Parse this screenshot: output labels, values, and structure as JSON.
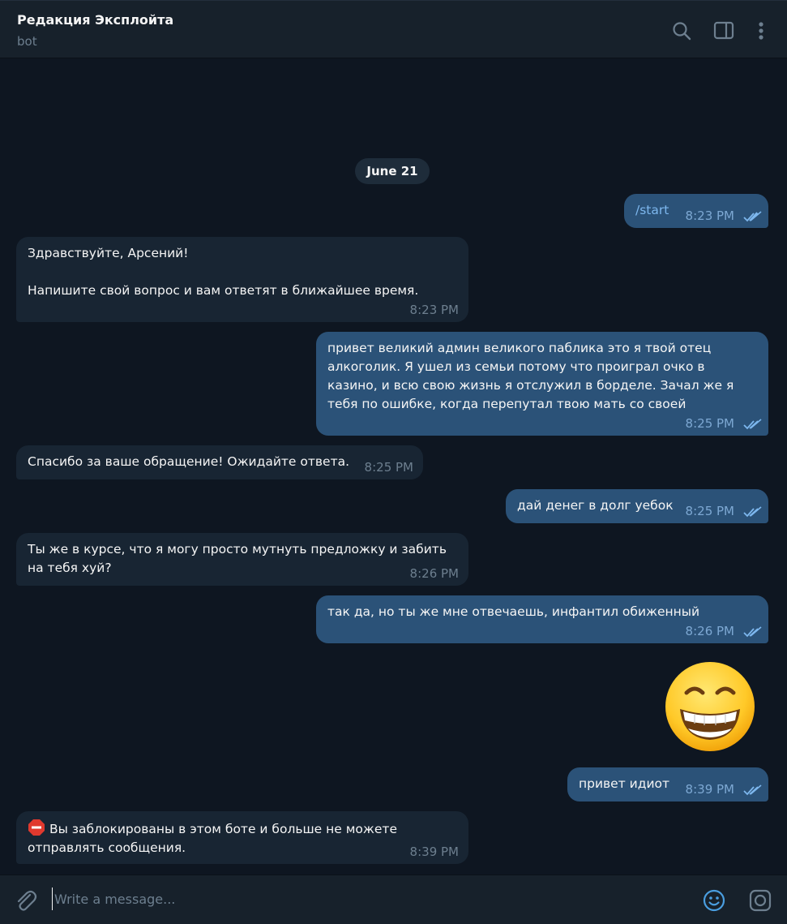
{
  "header": {
    "title": "Редакция Эксплойта",
    "status": "bot",
    "icons": [
      "search-icon",
      "sidebar-toggle-icon",
      "more-vertical-icon"
    ]
  },
  "date_separator": "June 21",
  "messages": [
    {
      "dir": "out",
      "text": "/start",
      "time": "8:23 PM",
      "read": true
    },
    {
      "dir": "in",
      "text": "Здравствуйте, Арсений!\n\nНапишите свой вопрос и вам ответят в ближайшее время.",
      "time": "8:23 PM"
    },
    {
      "dir": "out",
      "text": "привет великий админ великого паблика это я твой отец\nалкоголик. Я ушел из семьи потому что проиграл очко в\nказино, и всю свою жизнь я отслужил в борделе. Зачал же я\nтебя по ошибке, когда перепутал твою мать со своей",
      "time": "8:25 PM",
      "read": true
    },
    {
      "dir": "in",
      "text": "Спасибо за ваше обращение! Ожидайте ответа.",
      "time": "8:25 PM"
    },
    {
      "dir": "out",
      "text": "дай денег в долг уебок",
      "time": "8:25 PM",
      "read": true
    },
    {
      "dir": "in",
      "text": "Ты же в курсе, что я могу просто мутнуть предложку и забить\nна тебя хуй?",
      "time": "8:26 PM"
    },
    {
      "dir": "out",
      "text": "так да, но ты же мне отвечаешь, инфантил обиженный",
      "time": "8:26 PM",
      "read": true
    },
    {
      "dir": "out",
      "sticker": "grinning-face-with-smiling-eyes-emoji"
    },
    {
      "dir": "out",
      "text": "привет идиот",
      "time": "8:39 PM",
      "read": true
    },
    {
      "dir": "in",
      "icon": "stop-sign-emoji",
      "text": "Вы заблокированы в этом боте и больше не можете\nотправлять сообщения.",
      "time": "8:39 PM"
    }
  ],
  "composer": {
    "placeholder": "Write a message...",
    "icons": [
      "paperclip-icon",
      "emoji-icon",
      "camera-icon"
    ]
  },
  "colors": {
    "background": "#0e1621",
    "header": "#17212b",
    "incoming_bubble": "#182533",
    "outgoing_bubble": "#2b5278",
    "outgoing_time": "#7da8d3",
    "muted_text": "#6d7f8f"
  }
}
